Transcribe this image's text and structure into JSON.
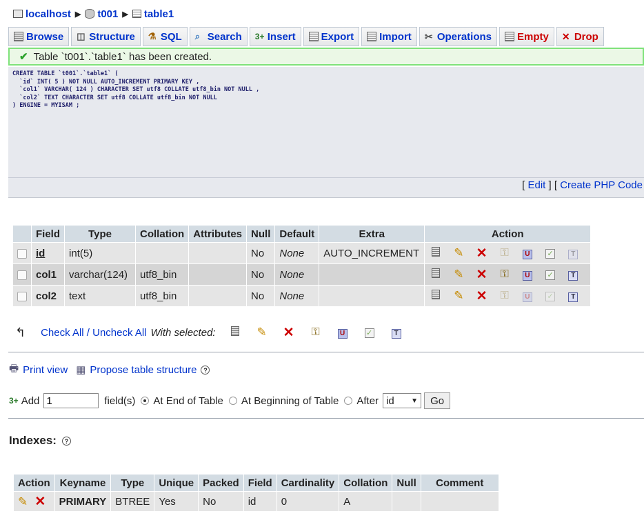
{
  "breadcrumb": {
    "server": "localhost",
    "database": "t001",
    "table": "table1"
  },
  "tabs": [
    {
      "label": "Browse",
      "icon": "browse-icon"
    },
    {
      "label": "Structure",
      "icon": "structure-icon"
    },
    {
      "label": "SQL",
      "icon": "sql-icon"
    },
    {
      "label": "Search",
      "icon": "search-icon"
    },
    {
      "label": "Insert",
      "icon": "insert-icon"
    },
    {
      "label": "Export",
      "icon": "export-icon"
    },
    {
      "label": "Import",
      "icon": "import-icon"
    },
    {
      "label": "Operations",
      "icon": "operations-icon"
    },
    {
      "label": "Empty",
      "icon": "empty-icon"
    },
    {
      "label": "Drop",
      "icon": "drop-icon"
    }
  ],
  "notice": {
    "message": "Table `t001`.`table1` has been created."
  },
  "sql": {
    "line1": "CREATE TABLE `t001`.`table1` (",
    "line2": "`id` INT( 5 ) NOT NULL AUTO_INCREMENT PRIMARY KEY ,",
    "line3": "`col1` VARCHAR( 124 ) CHARACTER SET utf8 COLLATE utf8_bin NOT NULL ,",
    "line4": "`col2` TEXT CHARACTER SET utf8 COLLATE utf8_bin NOT NULL",
    "line5": ") ENGINE = MYISAM ;",
    "edit_link": "Edit",
    "php_link": "Create PHP Code"
  },
  "structure": {
    "headers": [
      "Field",
      "Type",
      "Collation",
      "Attributes",
      "Null",
      "Default",
      "Extra",
      "Action"
    ],
    "rows": [
      {
        "field": "id",
        "type": "int(5)",
        "collation": "",
        "attributes": "",
        "null": "No",
        "default": "None",
        "extra": "AUTO_INCREMENT"
      },
      {
        "field": "col1",
        "type": "varchar(124)",
        "collation": "utf8_bin",
        "attributes": "",
        "null": "No",
        "default": "None",
        "extra": ""
      },
      {
        "field": "col2",
        "type": "text",
        "collation": "utf8_bin",
        "attributes": "",
        "null": "No",
        "default": "None",
        "extra": ""
      }
    ],
    "check_all": "Check All / Uncheck All",
    "with_selected": "With selected:"
  },
  "tools": {
    "print_view": "Print view",
    "propose": "Propose table structure"
  },
  "add_field": {
    "add_label": "Add",
    "count": "1",
    "fields_label": "field(s)",
    "at_end": "At End of Table",
    "at_beginning": "At Beginning of Table",
    "after": "After",
    "after_column": "id",
    "go": "Go"
  },
  "indexes": {
    "title": "Indexes:",
    "headers": [
      "Action",
      "Keyname",
      "Type",
      "Unique",
      "Packed",
      "Field",
      "Cardinality",
      "Collation",
      "Null",
      "Comment"
    ],
    "rows": [
      {
        "keyname": "PRIMARY",
        "type": "BTREE",
        "unique": "Yes",
        "packed": "No",
        "field": "id",
        "cardinality": "0",
        "collation": "A",
        "null": "",
        "comment": ""
      }
    ]
  },
  "colors": {
    "link": "#0033cc",
    "danger": "#cc0000",
    "success_border": "#7fe27a",
    "header_bg": "#d3dce3"
  }
}
